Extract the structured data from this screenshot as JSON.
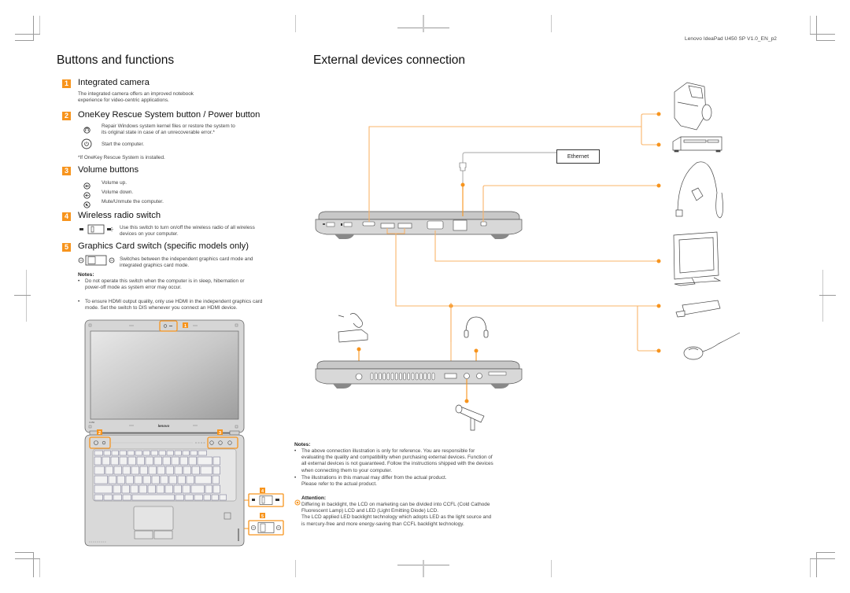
{
  "header": {
    "doc_code": "Lenovo IdeaPad U450 SP V1.0_EN_p2"
  },
  "colors": {
    "accent": "#f7941d",
    "connector_line": "#f9b46a",
    "connector_dot": "#f7941d",
    "text": "#444444"
  },
  "left": {
    "title": "Buttons and functions",
    "sections": [
      {
        "number": "1",
        "title": "Integrated camera",
        "text": [
          "The integrated camera offers an improved notebook",
          "experience for video-centric applications."
        ]
      },
      {
        "number": "2",
        "title": "OneKey Rescue System button / Power button",
        "items": [
          {
            "icon": "onekey-rescue-icon",
            "text": [
              "Repair Windows system kernel files or restore the system to",
              "its original state in case of an unrecoverable error.*"
            ]
          },
          {
            "icon": "power-icon",
            "text": [
              "Start the computer."
            ]
          }
        ],
        "footnote": "*If OneKey Rescue System is installed."
      },
      {
        "number": "3",
        "title": "Volume buttons",
        "items": [
          {
            "icon": "volume-up-icon",
            "text": [
              "Volume up."
            ]
          },
          {
            "icon": "volume-down-icon",
            "text": [
              "Volume down."
            ]
          },
          {
            "icon": "mute-icon",
            "text": [
              "Mute/Unmute the computer."
            ]
          }
        ]
      },
      {
        "number": "4",
        "title": "Wireless radio switch",
        "items": [
          {
            "icon": "wireless-switch-icon",
            "text": [
              "Use this switch to turn on/off the wireless radio of all wireless",
              "devices on your computer."
            ]
          }
        ]
      },
      {
        "number": "5",
        "title": "Graphics Card switch (specific models only)",
        "items": [
          {
            "icon": "graphics-switch-icon",
            "text": [
              "Switches between the independent graphics card mode and",
              "integrated graphics card mode."
            ]
          }
        ],
        "notes_title": "Notes:",
        "notes": [
          [
            "Do not operate this switch when the computer is in sleep, hibernation or",
            "power-off mode as system error may occur."
          ],
          [
            "To ensure HDMI output quality, only use HDMI in the independent graphics card",
            "mode. Set the switch to DIS whenever you connect an HDMI device."
          ]
        ]
      }
    ],
    "illustration": {
      "brand": "lenovo",
      "model": "U450",
      "callouts": [
        "1",
        "2",
        "3",
        "4",
        "5"
      ]
    }
  },
  "right": {
    "title": "External devices connection",
    "ethernet_label": "Ethernet",
    "devices": [
      "camcorder",
      "dvd-player",
      "security-lock",
      "monitor",
      "usb-flash-drive",
      "mouse",
      "power-adapter",
      "headphones",
      "microphone"
    ],
    "notes_title": "Notes:",
    "notes": [
      [
        "The above connection illustration is only for reference. You are responsible for",
        "evaluating the quality and compatibility when purchasing external devices. Function of",
        "all external devices is not guaranteed. Follow the instructions shipped with the devices",
        "when connecting them to your computer."
      ],
      [
        "The illustrations in this manual may differ from the actual product.",
        "Please refer to the actual product."
      ]
    ],
    "attention_title": "Attention:",
    "attention_text": [
      "Differing in backlight, the LCD on marketing can be divided into CCFL (Cold Cathode",
      "Fluorescent Lamp) LCD and LED (Light Emitting Diode) LCD.",
      "The LCD applied LED backlight technology which adopts LED as the light source and",
      "is mercury-free and more energy-saving than CCFL backlight technology."
    ]
  }
}
